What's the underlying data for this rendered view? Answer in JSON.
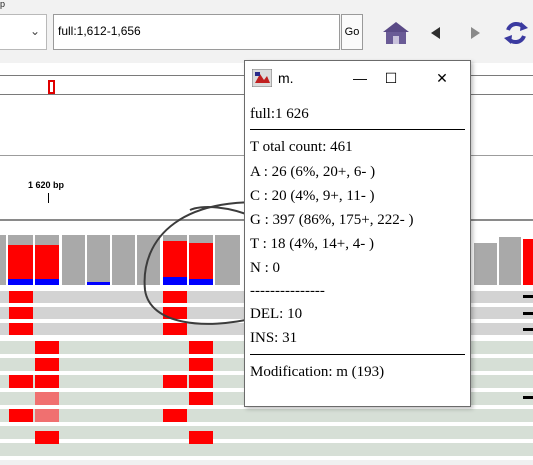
{
  "toolbar": {
    "locus_value": "full:1,612-1,656",
    "go_label": "Go",
    "top_stub_text": "p"
  },
  "icons": {
    "genome_dropdown": "chevron-down-icon",
    "home": "home-icon",
    "back": "arrow-left-icon",
    "forward": "arrow-right-icon",
    "refresh": "refresh-icon"
  },
  "ruler": {
    "label": "1 620 bp"
  },
  "popup": {
    "title": "m.",
    "minimize": "—",
    "maximize": "☐",
    "close": "✕",
    "position": "full:1 626",
    "total_count": "T otal count: 461",
    "base_a": "A : 26 (6%, 20+, 6- )",
    "base_c": "C : 20 (4%, 9+, 11- )",
    "base_g": "G : 397 (86%, 175+, 222- )",
    "base_t": "T  : 18 (4%, 14+, 4- )",
    "base_n": "N : 0",
    "dashes": "---------------",
    "del": "DEL: 10",
    "ins": "INS: 31",
    "modification": "Modification: m (193)"
  },
  "colors": {
    "mismatch_red": "#ff0000",
    "coverage_gray": "#a9a9a9",
    "read_gray": "#d3d3d3",
    "read_green": "#d6dfd6",
    "modification_blue": "#0000ff",
    "annotation_ink": "#3c3c3c"
  }
}
